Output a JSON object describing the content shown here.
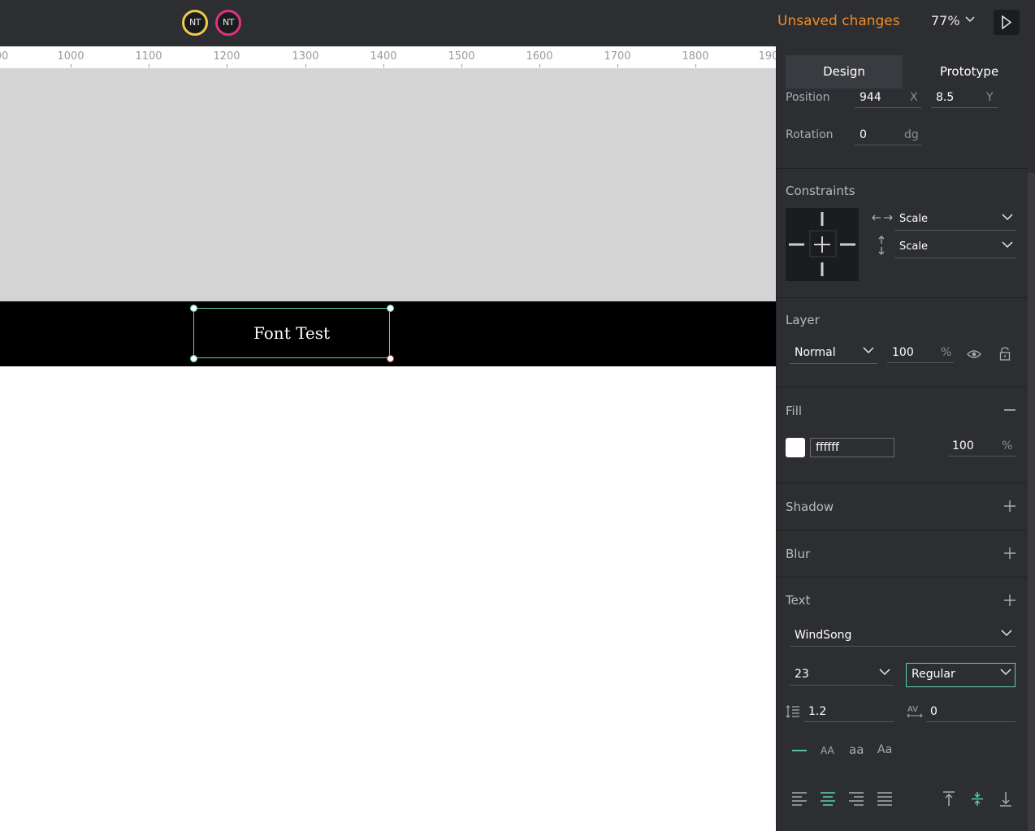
{
  "topbar": {
    "avatars": [
      "NT",
      "NT"
    ],
    "status": "Unsaved changes",
    "zoom": "77%"
  },
  "ruler": {
    "ticks": [
      "00",
      "1000",
      "1100",
      "1200",
      "1300",
      "1400",
      "1500",
      "1600",
      "1700",
      "1800",
      "190"
    ]
  },
  "canvas": {
    "selected_text": "Font Test"
  },
  "panel": {
    "tabs": {
      "design": "Design",
      "prototype": "Prototype"
    },
    "position": {
      "label": "Position",
      "x": "944",
      "x_label": "X",
      "y": "8.5",
      "y_label": "Y"
    },
    "rotation": {
      "label": "Rotation",
      "value": "0",
      "unit": "dg"
    },
    "constraints": {
      "title": "Constraints",
      "horizontal": "Scale",
      "vertical": "Scale"
    },
    "layer": {
      "title": "Layer",
      "blend": "Normal",
      "opacity": "100",
      "unit": "%"
    },
    "fill": {
      "title": "Fill",
      "hex": "ffffff",
      "opacity": "100",
      "unit": "%"
    },
    "shadow": {
      "title": "Shadow"
    },
    "blur": {
      "title": "Blur"
    },
    "text": {
      "title": "Text",
      "font": "WindSong",
      "size": "23",
      "weight": "Regular",
      "line_height": "1.2",
      "letter_spacing": "0",
      "case_upper": "AA",
      "case_lower": "aa",
      "case_title": "Aa"
    }
  },
  "colors": {
    "accent": "#5cd1ab",
    "warning": "#f28c28",
    "panel_bg": "#2d2e32"
  }
}
